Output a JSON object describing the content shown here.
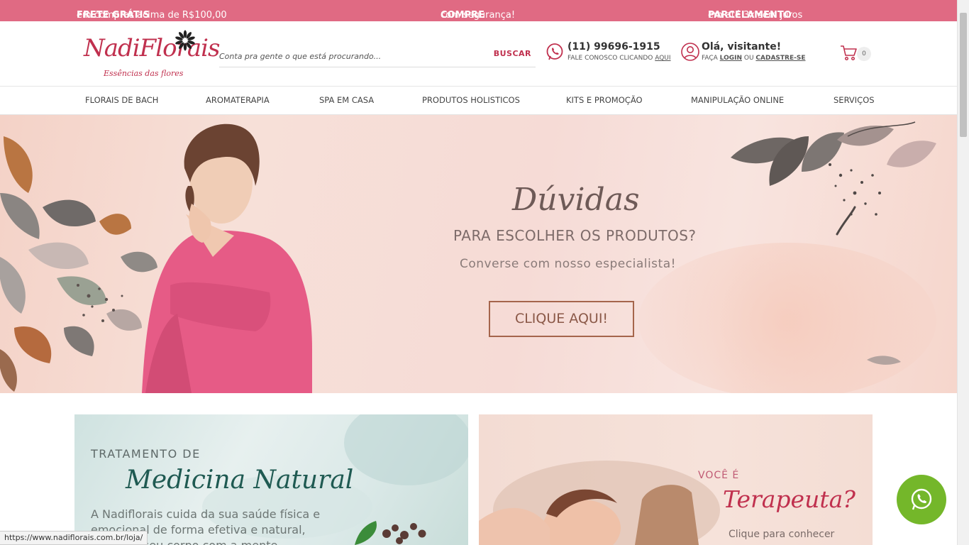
{
  "promo": {
    "item1_bold": "FRETE GRÁTIS",
    "item1_rest": " em compras acima de R$100,00",
    "item2_bold": "COMPRE",
    "item2_rest": " com segurança!",
    "item3_bold": "PARCELAMENTO",
    "item3_rest": " em até 3x sem juros",
    "bar_color": "#e06a83"
  },
  "logo": {
    "name": "NadiFlorais",
    "tagline": "Essências das flores",
    "brand_color": "#c0304e"
  },
  "search": {
    "placeholder": "Conta pra gente o que está procurando...",
    "button_label": "BUSCAR"
  },
  "contact": {
    "icon": "whatsapp-icon",
    "phone": "(11) 99696-1915",
    "sub_prefix": "FALE CONOSCO CLICANDO ",
    "sub_link": "AQUI"
  },
  "account": {
    "icon": "user-icon",
    "greeting": "Olá, visitante!",
    "sub_prefix": "FAÇA ",
    "login_link": "LOGIN",
    "sub_middle": " OU ",
    "register_link": "CADASTRE-SE"
  },
  "cart": {
    "icon": "cart-icon",
    "count": "0"
  },
  "nav": {
    "items": [
      "FLORAIS DE BACH",
      "AROMATERAPIA",
      "SPA EM CASA",
      "PRODUTOS HOLISTICOS",
      "KITS E PROMOÇÃO",
      "MANIPULAÇÃO ONLINE",
      "SERVIÇOS"
    ]
  },
  "hero": {
    "title": "Dúvidas",
    "subtitle": "PARA ESCOLHER OS PRODUTOS?",
    "tagline": "Converse com nosso especialista!",
    "button_label": "CLIQUE AQUI!"
  },
  "cards": {
    "left": {
      "kicker": "TRATAMENTO DE",
      "title": "Medicina Natural",
      "body": "A Nadiflorais cuida da sua saúde física e emocional de forma efetiva e natural, tratando seu corpo com a mente."
    },
    "right": {
      "kicker": "VOCÊ É",
      "title": "Terapeuta?",
      "body": "Clique para conhecer"
    }
  },
  "whatsapp_float": {
    "icon": "whatsapp-icon",
    "color": "#74b72a"
  },
  "status_bar": {
    "url": "https://www.nadiflorais.com.br/loja/"
  }
}
